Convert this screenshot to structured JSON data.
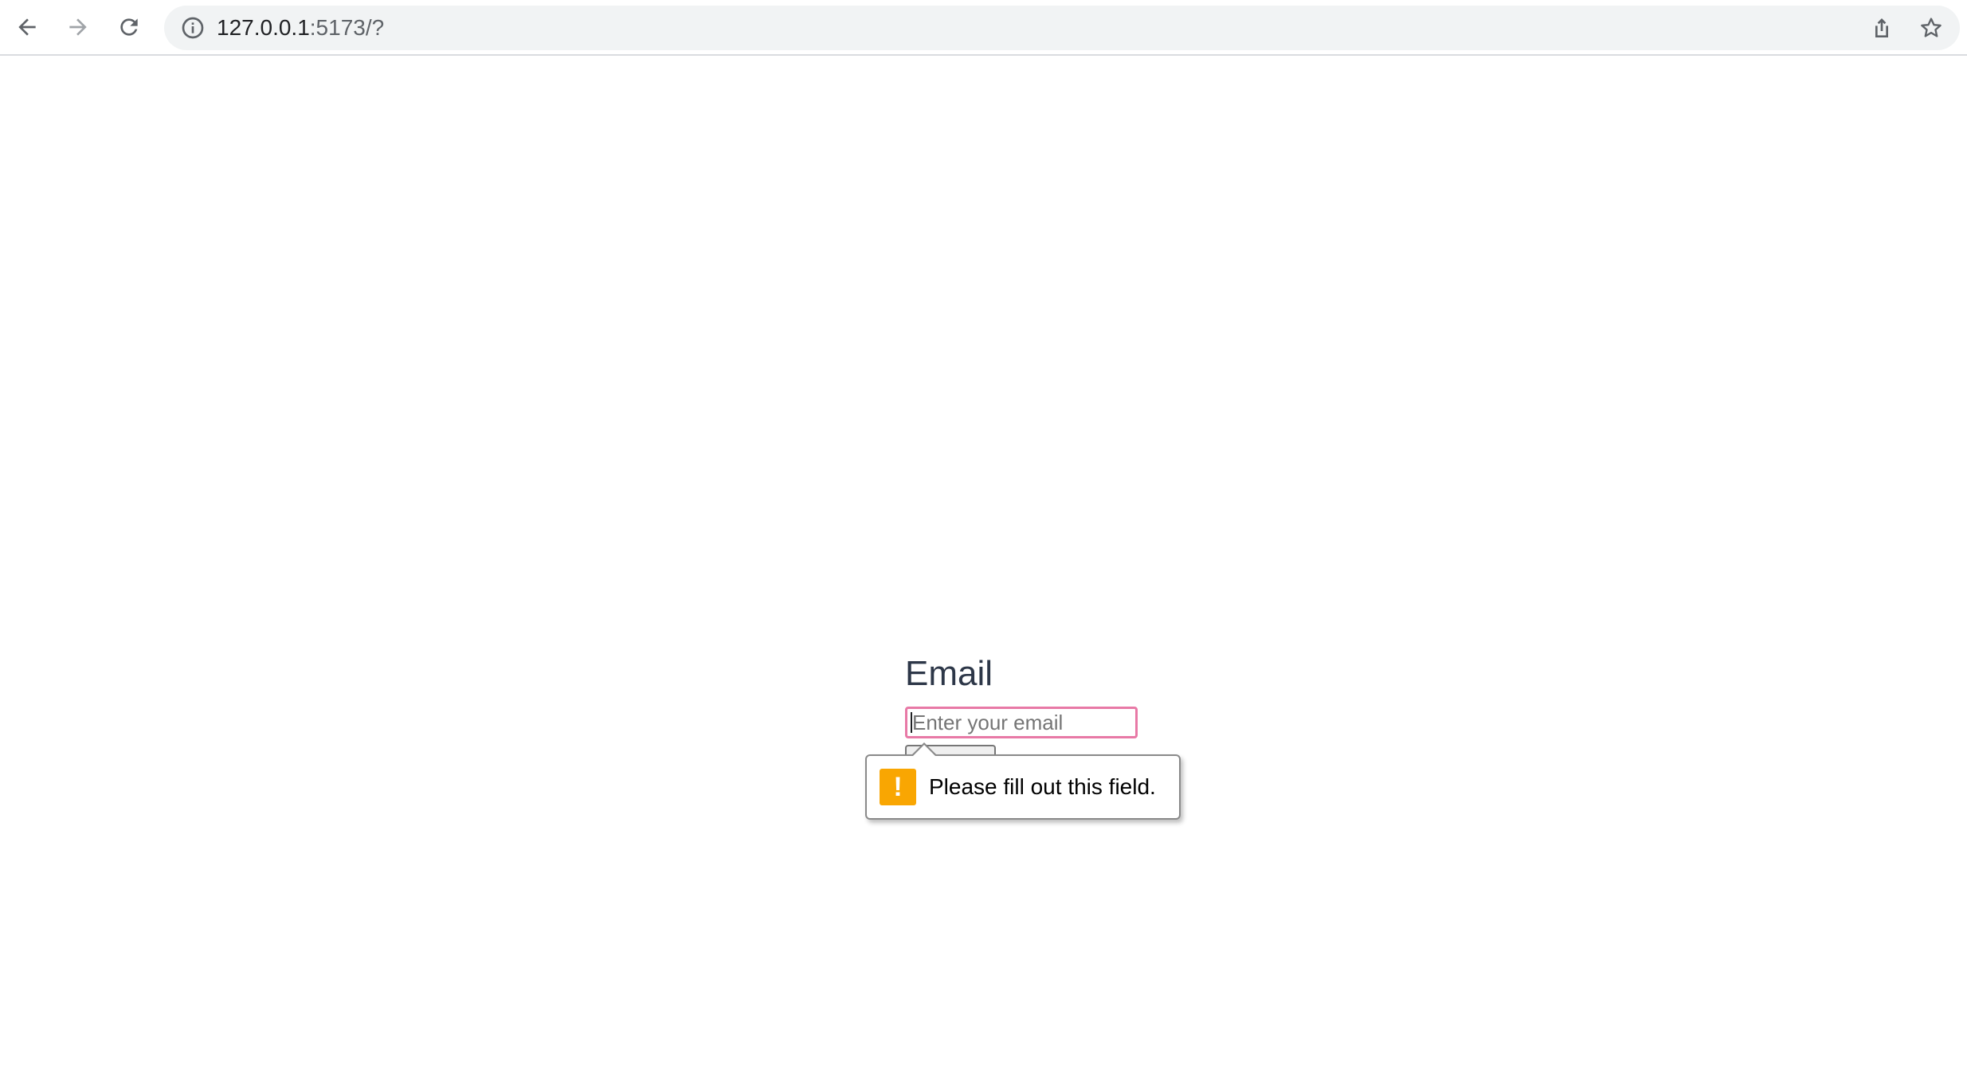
{
  "browser": {
    "url_host": "127.0.0.1",
    "url_path": ":5173/?",
    "icons": {
      "back": "arrow-left-icon",
      "forward": "arrow-right-icon",
      "reload": "reload-icon",
      "site_info": "info-icon",
      "share": "share-icon",
      "bookmark": "star-icon"
    }
  },
  "form": {
    "label": "Email",
    "email_placeholder": "Enter your email",
    "email_value": ""
  },
  "validation": {
    "message": "Please fill out this field.",
    "icon": "exclamation-icon",
    "icon_glyph": "!",
    "icon_color": "#f9a602",
    "input_invalid_border_color": "#e879a6"
  }
}
